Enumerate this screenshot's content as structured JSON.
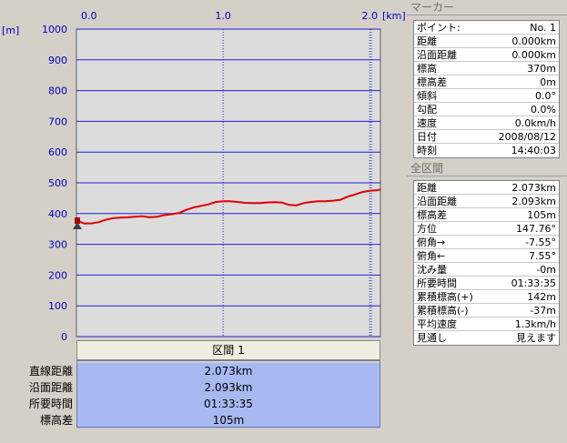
{
  "chart_data": {
    "type": "line",
    "x_unit": "[km]",
    "y_unit": "[m]",
    "xlim": [
      0,
      2.073
    ],
    "ylim": [
      0,
      1000
    ],
    "x_ticks": [
      "0.0",
      "1.0",
      "2.0"
    ],
    "y_ticks": [
      "0",
      "100",
      "200",
      "300",
      "400",
      "500",
      "600",
      "700",
      "800",
      "900",
      "1000"
    ],
    "grid": true,
    "line_color": "#e00000",
    "series": [
      {
        "x": [
          0.0,
          0.02,
          0.05,
          0.1,
          0.15,
          0.2,
          0.25,
          0.3,
          0.35,
          0.4,
          0.45,
          0.5,
          0.55,
          0.6,
          0.65,
          0.7,
          0.75,
          0.8,
          0.85,
          0.9,
          0.95,
          1.0,
          1.05,
          1.1,
          1.15,
          1.2,
          1.25,
          1.3,
          1.35,
          1.4,
          1.45,
          1.5,
          1.55,
          1.6,
          1.65,
          1.7,
          1.75,
          1.8,
          1.85,
          1.9,
          1.95,
          2.0,
          2.05,
          2.073
        ],
        "y": [
          370,
          375,
          368,
          368,
          372,
          380,
          385,
          387,
          388,
          390,
          391,
          388,
          390,
          395,
          398,
          402,
          412,
          420,
          425,
          430,
          438,
          440,
          440,
          438,
          435,
          434,
          434,
          436,
          437,
          436,
          428,
          427,
          434,
          438,
          440,
          440,
          442,
          445,
          455,
          462,
          470,
          474,
          476,
          478
        ]
      }
    ]
  },
  "section": {
    "header": "区間 1",
    "rows": [
      {
        "label": "直線距離",
        "value": "2.073km"
      },
      {
        "label": "沿面距離",
        "value": "2.093km"
      },
      {
        "label": "所要時間",
        "value": "01:33:35"
      },
      {
        "label": "標高差",
        "value": "105m"
      }
    ]
  },
  "marker_panel": {
    "title": "マーカー",
    "rows": [
      {
        "label": "ポイント:",
        "value": "No. 1"
      },
      {
        "label": "距離",
        "value": "0.000km"
      },
      {
        "label": "沿面距離",
        "value": "0.000km"
      },
      {
        "label": "標高",
        "value": "370m"
      },
      {
        "label": "標高差",
        "value": "0m"
      },
      {
        "label": "傾斜",
        "value": "0.0°"
      },
      {
        "label": "勾配",
        "value": "0.0%"
      },
      {
        "label": "速度",
        "value": "0.0km/h"
      },
      {
        "label": "日付",
        "value": "2008/08/12"
      },
      {
        "label": "時刻",
        "value": "14:40:03"
      }
    ]
  },
  "all_section_panel": {
    "title": "全区間",
    "rows": [
      {
        "label": "距離",
        "value": "2.073km"
      },
      {
        "label": "沿面距離",
        "value": "2.093km"
      },
      {
        "label": "標高差",
        "value": "105m"
      },
      {
        "label": "方位",
        "value": "147.76°"
      },
      {
        "label": "俯角→",
        "value": "-7.55°"
      },
      {
        "label": "俯角←",
        "value": "7.55°"
      },
      {
        "label": "沈み量",
        "value": "-0m"
      },
      {
        "label": "所要時間",
        "value": "01:33:35"
      },
      {
        "label": "累積標高(+)",
        "value": "142m"
      },
      {
        "label": "累積標高(-)",
        "value": "-37m"
      },
      {
        "label": "平均速度",
        "value": "1.3km/h"
      },
      {
        "label": "見通し",
        "value": "見えます"
      }
    ]
  }
}
